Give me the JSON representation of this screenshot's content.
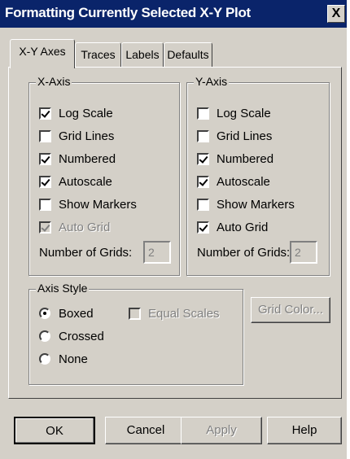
{
  "window": {
    "title": "Formatting Currently Selected X-Y Plot",
    "close_glyph": "X"
  },
  "tabs": [
    {
      "label": "X-Y Axes",
      "active": true
    },
    {
      "label": "Traces",
      "active": false
    },
    {
      "label": "Labels",
      "active": false
    },
    {
      "label": "Defaults",
      "active": false
    }
  ],
  "x_axis": {
    "title": "X-Axis",
    "options": [
      {
        "label": "Log Scale",
        "checked": true,
        "enabled": true
      },
      {
        "label": "Grid Lines",
        "checked": false,
        "enabled": true
      },
      {
        "label": "Numbered",
        "checked": true,
        "enabled": true
      },
      {
        "label": "Autoscale",
        "checked": true,
        "enabled": true
      },
      {
        "label": "Show Markers",
        "checked": false,
        "enabled": true
      },
      {
        "label": "Auto Grid",
        "checked": true,
        "enabled": false
      }
    ],
    "grids_label": "Number of Grids:",
    "grids_value": "2"
  },
  "y_axis": {
    "title": "Y-Axis",
    "options": [
      {
        "label": "Log Scale",
        "checked": false,
        "enabled": true
      },
      {
        "label": "Grid Lines",
        "checked": false,
        "enabled": true
      },
      {
        "label": "Numbered",
        "checked": true,
        "enabled": true
      },
      {
        "label": "Autoscale",
        "checked": true,
        "enabled": true
      },
      {
        "label": "Show Markers",
        "checked": false,
        "enabled": true
      },
      {
        "label": "Auto Grid",
        "checked": true,
        "enabled": true
      }
    ],
    "grids_label": "Number of Grids:",
    "grids_value": "2"
  },
  "axis_style": {
    "title": "Axis Style",
    "options": [
      {
        "label": "Boxed",
        "selected": true
      },
      {
        "label": "Crossed",
        "selected": false
      },
      {
        "label": "None",
        "selected": false
      }
    ],
    "equal_scales_label": "Equal Scales",
    "equal_scales_checked": false
  },
  "grid_color_label": "Grid Color...",
  "buttons": {
    "ok": "OK",
    "cancel": "Cancel",
    "apply": "Apply",
    "help": "Help"
  }
}
